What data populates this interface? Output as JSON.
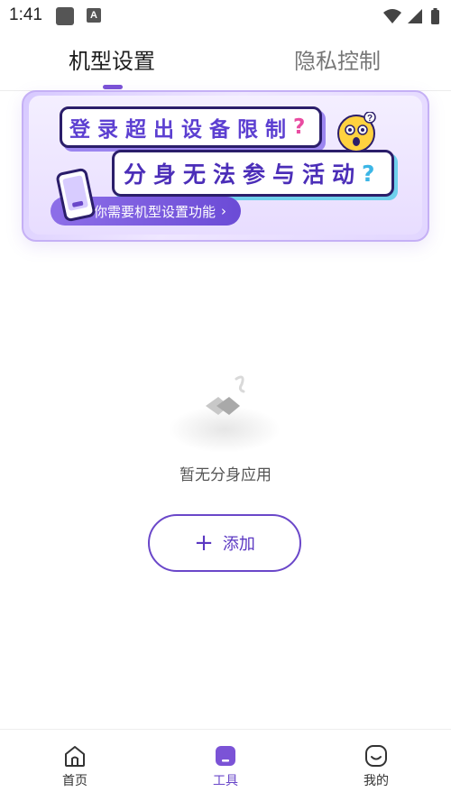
{
  "status_bar": {
    "time": "1:41",
    "indicator": "A"
  },
  "tabs": [
    {
      "label": "机型设置",
      "active": true
    },
    {
      "label": "隐私控制",
      "active": false
    }
  ],
  "banner": {
    "line1": "登录超出设备限制",
    "line1_mark": "?",
    "line2": "分身无法参与活动",
    "line2_mark": "?",
    "pill": "你需要机型设置功能",
    "emoji_mark": "?"
  },
  "empty_state": {
    "text": "暂无分身应用"
  },
  "add_button": {
    "label": "添加"
  },
  "bottom_nav": [
    {
      "label": "首页",
      "icon": "home-icon",
      "active": false
    },
    {
      "label": "工具",
      "icon": "tools-icon",
      "active": true
    },
    {
      "label": "我的",
      "icon": "smile-face-icon",
      "active": false
    }
  ],
  "colors": {
    "accent": "#6a47c9",
    "banner_bg": "#e8ddff"
  }
}
